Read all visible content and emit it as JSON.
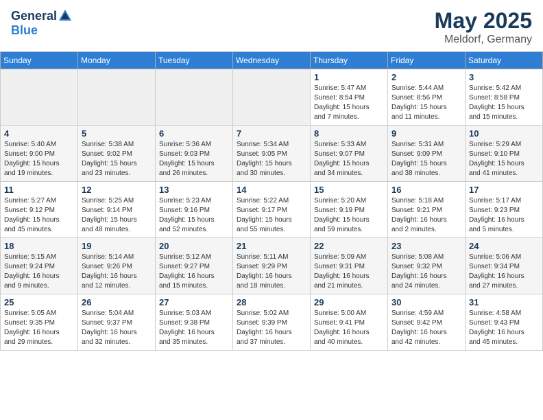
{
  "header": {
    "logo_general": "General",
    "logo_blue": "Blue",
    "month_year": "May 2025",
    "location": "Meldorf, Germany"
  },
  "weekdays": [
    "Sunday",
    "Monday",
    "Tuesday",
    "Wednesday",
    "Thursday",
    "Friday",
    "Saturday"
  ],
  "weeks": [
    [
      {
        "day": "",
        "info": ""
      },
      {
        "day": "",
        "info": ""
      },
      {
        "day": "",
        "info": ""
      },
      {
        "day": "",
        "info": ""
      },
      {
        "day": "1",
        "info": "Sunrise: 5:47 AM\nSunset: 8:54 PM\nDaylight: 15 hours\nand 7 minutes."
      },
      {
        "day": "2",
        "info": "Sunrise: 5:44 AM\nSunset: 8:56 PM\nDaylight: 15 hours\nand 11 minutes."
      },
      {
        "day": "3",
        "info": "Sunrise: 5:42 AM\nSunset: 8:58 PM\nDaylight: 15 hours\nand 15 minutes."
      }
    ],
    [
      {
        "day": "4",
        "info": "Sunrise: 5:40 AM\nSunset: 9:00 PM\nDaylight: 15 hours\nand 19 minutes."
      },
      {
        "day": "5",
        "info": "Sunrise: 5:38 AM\nSunset: 9:02 PM\nDaylight: 15 hours\nand 23 minutes."
      },
      {
        "day": "6",
        "info": "Sunrise: 5:36 AM\nSunset: 9:03 PM\nDaylight: 15 hours\nand 26 minutes."
      },
      {
        "day": "7",
        "info": "Sunrise: 5:34 AM\nSunset: 9:05 PM\nDaylight: 15 hours\nand 30 minutes."
      },
      {
        "day": "8",
        "info": "Sunrise: 5:33 AM\nSunset: 9:07 PM\nDaylight: 15 hours\nand 34 minutes."
      },
      {
        "day": "9",
        "info": "Sunrise: 5:31 AM\nSunset: 9:09 PM\nDaylight: 15 hours\nand 38 minutes."
      },
      {
        "day": "10",
        "info": "Sunrise: 5:29 AM\nSunset: 9:10 PM\nDaylight: 15 hours\nand 41 minutes."
      }
    ],
    [
      {
        "day": "11",
        "info": "Sunrise: 5:27 AM\nSunset: 9:12 PM\nDaylight: 15 hours\nand 45 minutes."
      },
      {
        "day": "12",
        "info": "Sunrise: 5:25 AM\nSunset: 9:14 PM\nDaylight: 15 hours\nand 48 minutes."
      },
      {
        "day": "13",
        "info": "Sunrise: 5:23 AM\nSunset: 9:16 PM\nDaylight: 15 hours\nand 52 minutes."
      },
      {
        "day": "14",
        "info": "Sunrise: 5:22 AM\nSunset: 9:17 PM\nDaylight: 15 hours\nand 55 minutes."
      },
      {
        "day": "15",
        "info": "Sunrise: 5:20 AM\nSunset: 9:19 PM\nDaylight: 15 hours\nand 59 minutes."
      },
      {
        "day": "16",
        "info": "Sunrise: 5:18 AM\nSunset: 9:21 PM\nDaylight: 16 hours\nand 2 minutes."
      },
      {
        "day": "17",
        "info": "Sunrise: 5:17 AM\nSunset: 9:23 PM\nDaylight: 16 hours\nand 5 minutes."
      }
    ],
    [
      {
        "day": "18",
        "info": "Sunrise: 5:15 AM\nSunset: 9:24 PM\nDaylight: 16 hours\nand 9 minutes."
      },
      {
        "day": "19",
        "info": "Sunrise: 5:14 AM\nSunset: 9:26 PM\nDaylight: 16 hours\nand 12 minutes."
      },
      {
        "day": "20",
        "info": "Sunrise: 5:12 AM\nSunset: 9:27 PM\nDaylight: 16 hours\nand 15 minutes."
      },
      {
        "day": "21",
        "info": "Sunrise: 5:11 AM\nSunset: 9:29 PM\nDaylight: 16 hours\nand 18 minutes."
      },
      {
        "day": "22",
        "info": "Sunrise: 5:09 AM\nSunset: 9:31 PM\nDaylight: 16 hours\nand 21 minutes."
      },
      {
        "day": "23",
        "info": "Sunrise: 5:08 AM\nSunset: 9:32 PM\nDaylight: 16 hours\nand 24 minutes."
      },
      {
        "day": "24",
        "info": "Sunrise: 5:06 AM\nSunset: 9:34 PM\nDaylight: 16 hours\nand 27 minutes."
      }
    ],
    [
      {
        "day": "25",
        "info": "Sunrise: 5:05 AM\nSunset: 9:35 PM\nDaylight: 16 hours\nand 29 minutes."
      },
      {
        "day": "26",
        "info": "Sunrise: 5:04 AM\nSunset: 9:37 PM\nDaylight: 16 hours\nand 32 minutes."
      },
      {
        "day": "27",
        "info": "Sunrise: 5:03 AM\nSunset: 9:38 PM\nDaylight: 16 hours\nand 35 minutes."
      },
      {
        "day": "28",
        "info": "Sunrise: 5:02 AM\nSunset: 9:39 PM\nDaylight: 16 hours\nand 37 minutes."
      },
      {
        "day": "29",
        "info": "Sunrise: 5:00 AM\nSunset: 9:41 PM\nDaylight: 16 hours\nand 40 minutes."
      },
      {
        "day": "30",
        "info": "Sunrise: 4:59 AM\nSunset: 9:42 PM\nDaylight: 16 hours\nand 42 minutes."
      },
      {
        "day": "31",
        "info": "Sunrise: 4:58 AM\nSunset: 9:43 PM\nDaylight: 16 hours\nand 45 minutes."
      }
    ]
  ]
}
